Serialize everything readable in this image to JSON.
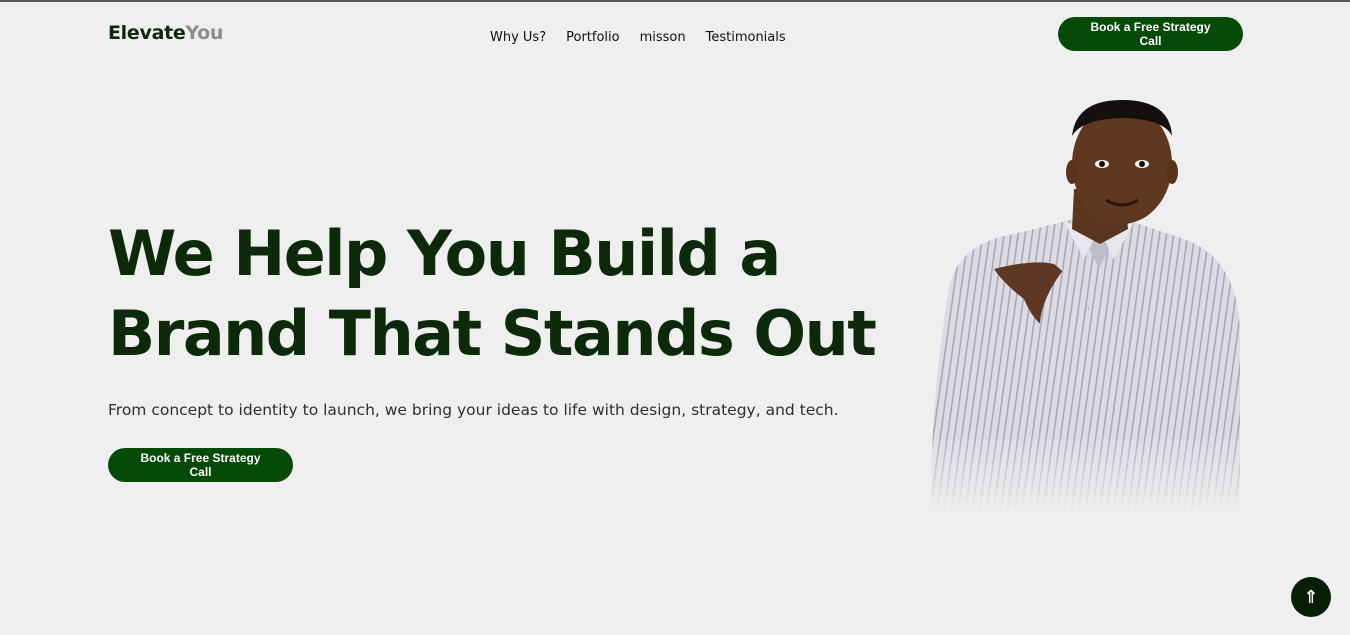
{
  "brand": {
    "part1": "Elevate",
    "part2": "You"
  },
  "nav": {
    "links": [
      "Why Us?",
      "Portfolio",
      "misson",
      "Testimonials"
    ],
    "cta_label": "Book a Free Strategy Call"
  },
  "hero": {
    "title_line1": "We Help You Build a",
    "title_line2": "Brand That Stands Out",
    "subtitle": "From concept to identity to launch, we bring your ideas to life with design, strategy, and tech.",
    "cta_label": "Book a Free Strategy Call"
  },
  "scroll_top": {
    "icon": "double-arrow-up-icon",
    "glyph": "⇑"
  },
  "colors": {
    "background": "#efefef",
    "primary_green": "#064a0a",
    "heading_dark": "#0c2a0a",
    "logo_grey": "#8d8d8d"
  }
}
